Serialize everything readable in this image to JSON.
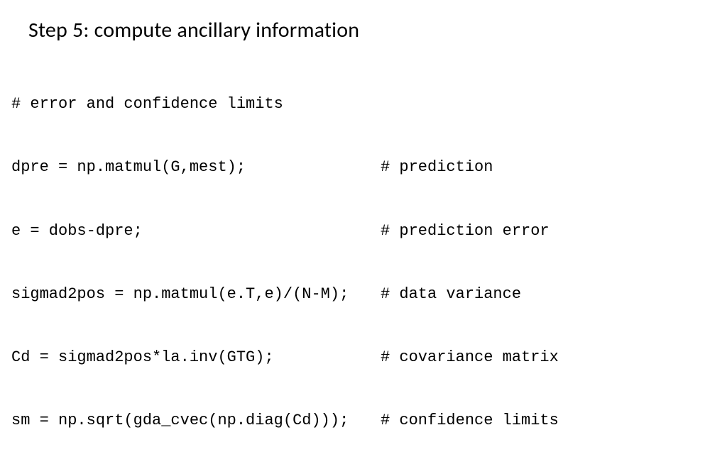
{
  "title": "Step 5: compute ancillary information",
  "code": {
    "comment0": "# error and confidence limits",
    "lines": [
      {
        "code": "dpre = np.matmul(G,mest);",
        "comment": "# prediction"
      },
      {
        "code": "e = dobs-dpre;",
        "comment": "# prediction error"
      },
      {
        "code": "sigmad2pos = np.matmul(e.T,e)/(N-M);",
        "comment": "# data variance"
      },
      {
        "code": "Cd = sigmad2pos*la.inv(GTG);",
        "comment": "# covariance matrix"
      },
      {
        "code": "sm = np.sqrt(gda_cvec(np.diag(Cd)));",
        "comment": "# confidence limits"
      }
    ]
  }
}
